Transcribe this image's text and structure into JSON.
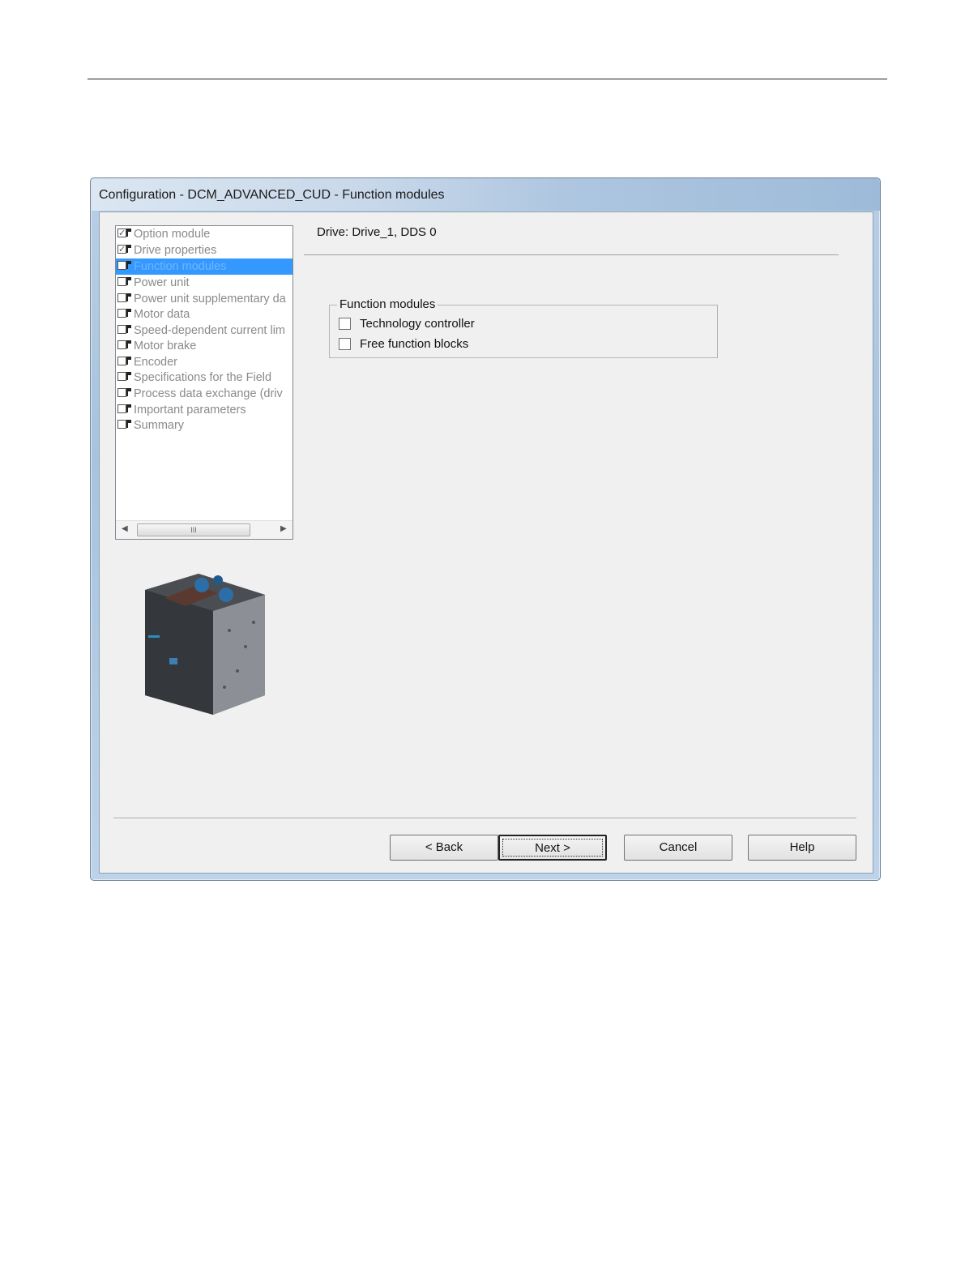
{
  "window": {
    "title": "Configuration - DCM_ADVANCED_CUD - Function modules"
  },
  "nav": {
    "items": [
      {
        "label": "Option module",
        "checked": true
      },
      {
        "label": "Drive properties",
        "checked": true
      },
      {
        "label": "Function modules",
        "checked": false,
        "selected": true
      },
      {
        "label": "Power unit",
        "checked": false
      },
      {
        "label": "Power unit supplementary da",
        "checked": false
      },
      {
        "label": "Motor data",
        "checked": false
      },
      {
        "label": "Speed-dependent current lim",
        "checked": false
      },
      {
        "label": "Motor brake",
        "checked": false
      },
      {
        "label": "Encoder",
        "checked": false
      },
      {
        "label": "Specifications for the Field",
        "checked": false
      },
      {
        "label": "Process data exchange (driv",
        "checked": false
      },
      {
        "label": "Important parameters",
        "checked": false
      },
      {
        "label": "Summary",
        "checked": false
      }
    ],
    "scroll_thumb_glyph": "III"
  },
  "content": {
    "drive_label": "Drive: Drive_1, DDS 0",
    "group": {
      "legend": "Function modules",
      "options": [
        {
          "label": "Technology controller",
          "checked": false
        },
        {
          "label": "Free function blocks",
          "checked": false
        }
      ]
    }
  },
  "buttons": {
    "back": "< Back",
    "next": "Next >",
    "cancel": "Cancel",
    "help": "Help"
  },
  "colors": {
    "selection": "#3399ff",
    "title_gradient_end": "#9dbbd9"
  }
}
